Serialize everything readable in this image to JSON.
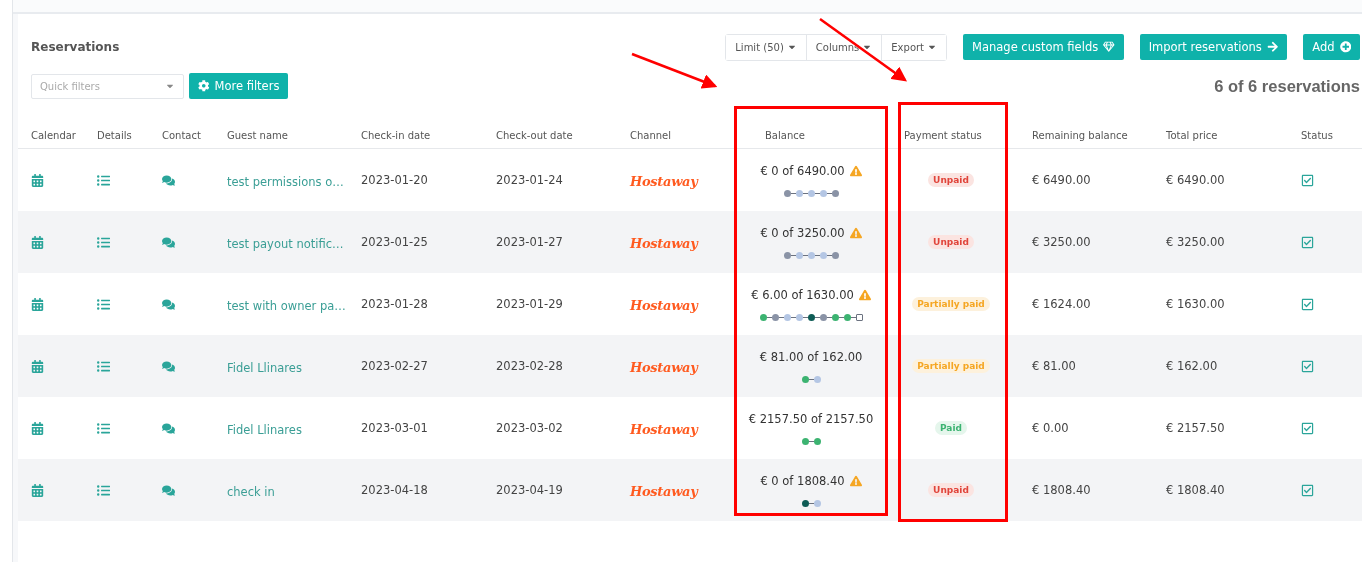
{
  "title": "Reservations",
  "toolbar": {
    "group": [
      {
        "label": "Limit (50)"
      },
      {
        "label": "Columns"
      },
      {
        "label": "Export"
      }
    ],
    "actions": [
      {
        "label": "Manage custom fields",
        "kind": "gem"
      },
      {
        "label": "Import reservations",
        "kind": "arrow"
      },
      {
        "label": "Add",
        "kind": "plus"
      }
    ]
  },
  "quick_filters": {
    "placeholder": "Quick filters"
  },
  "more_filters": "More filters",
  "count": "6 of 6 reservations",
  "columns": [
    {
      "label": "Calendar",
      "highlighted": false
    },
    {
      "label": "Details",
      "highlighted": false
    },
    {
      "label": "Contact",
      "highlighted": false
    },
    {
      "label": "Guest name",
      "highlighted": false
    },
    {
      "label": "Check-in date",
      "highlighted": false
    },
    {
      "label": "Check-out date",
      "highlighted": false
    },
    {
      "label": "Channel",
      "highlighted": false
    },
    {
      "label": "Balance",
      "highlighted": true
    },
    {
      "label": "Payment status",
      "highlighted": true
    },
    {
      "label": "Remaining balance",
      "highlighted": false
    },
    {
      "label": "Total price",
      "highlighted": false
    },
    {
      "label": "Status",
      "highlighted": false
    }
  ],
  "rows": [
    {
      "guest": "test permissions o…",
      "check_in": "2023-01-20",
      "check_out": "2023-01-24",
      "channel": "Hostaway",
      "balance": "€ 0 of 6490.00",
      "warning": true,
      "steps": [
        {
          "kind": "dot",
          "color": "#8a93a6"
        },
        {
          "kind": "dot",
          "color": "#b4c6e4"
        },
        {
          "kind": "dot",
          "color": "#b4c6e4"
        },
        {
          "kind": "dot",
          "color": "#b4c6e4"
        },
        {
          "kind": "dot",
          "color": "#8a93a6"
        }
      ],
      "payment": {
        "label": "Unpaid",
        "kind": "unpaid"
      },
      "remaining": "€ 6490.00",
      "total": "€ 6490.00",
      "confirmed": true
    },
    {
      "guest": "test payout notific…",
      "check_in": "2023-01-25",
      "check_out": "2023-01-27",
      "channel": "Hostaway",
      "balance": "€ 0 of 3250.00",
      "warning": true,
      "steps": [
        {
          "kind": "dot",
          "color": "#8a93a6"
        },
        {
          "kind": "dot",
          "color": "#b4c6e4"
        },
        {
          "kind": "dot",
          "color": "#b4c6e4"
        },
        {
          "kind": "dot",
          "color": "#b4c6e4"
        },
        {
          "kind": "dot",
          "color": "#8a93a6"
        }
      ],
      "payment": {
        "label": "Unpaid",
        "kind": "unpaid"
      },
      "remaining": "€ 3250.00",
      "total": "€ 3250.00",
      "confirmed": true
    },
    {
      "guest": "test with owner pa…",
      "check_in": "2023-01-28",
      "check_out": "2023-01-29",
      "channel": "Hostaway",
      "balance": "€ 6.00 of 1630.00",
      "warning": true,
      "steps": [
        {
          "kind": "dot",
          "color": "#3cb371"
        },
        {
          "kind": "dot",
          "color": "#8a93a6"
        },
        {
          "kind": "dot",
          "color": "#b4c6e4"
        },
        {
          "kind": "dot",
          "color": "#b4c6e4"
        },
        {
          "kind": "dot",
          "color": "#0d5c55"
        },
        {
          "kind": "dot",
          "color": "#8a93a6"
        },
        {
          "kind": "dot",
          "color": "#3cb371"
        },
        {
          "kind": "dot",
          "color": "#3cb371"
        },
        {
          "kind": "square",
          "color": "#6b7280"
        }
      ],
      "payment": {
        "label": "Partially paid",
        "kind": "partial"
      },
      "remaining": "€ 1624.00",
      "total": "€ 1630.00",
      "confirmed": true
    },
    {
      "guest": "Fidel Llinares",
      "check_in": "2023-02-27",
      "check_out": "2023-02-28",
      "channel": "Hostaway",
      "balance": "€ 81.00 of 162.00",
      "warning": false,
      "steps": [
        {
          "kind": "dot",
          "color": "#3cb371"
        },
        {
          "kind": "dot",
          "color": "#b4c6e4"
        }
      ],
      "payment": {
        "label": "Partially paid",
        "kind": "partial"
      },
      "remaining": "€ 81.00",
      "total": "€ 162.00",
      "confirmed": true
    },
    {
      "guest": "Fidel Llinares",
      "check_in": "2023-03-01",
      "check_out": "2023-03-02",
      "channel": "Hostaway",
      "balance": "€ 2157.50 of 2157.50",
      "warning": false,
      "steps": [
        {
          "kind": "dot",
          "color": "#3cb371"
        },
        {
          "kind": "dot",
          "color": "#3cb371"
        }
      ],
      "payment": {
        "label": "Paid",
        "kind": "paid"
      },
      "remaining": "€ 0.00",
      "total": "€ 2157.50",
      "confirmed": true
    },
    {
      "guest": "check in",
      "check_in": "2023-04-18",
      "check_out": "2023-04-19",
      "channel": "Hostaway",
      "balance": "€ 0 of 1808.40",
      "warning": true,
      "steps": [
        {
          "kind": "dot",
          "color": "#0d5c55"
        },
        {
          "kind": "dot",
          "color": "#b4c6e4"
        }
      ],
      "payment": {
        "label": "Unpaid",
        "kind": "unpaid"
      },
      "remaining": "€ 1808.40",
      "total": "€ 1808.40",
      "confirmed": true
    }
  ]
}
